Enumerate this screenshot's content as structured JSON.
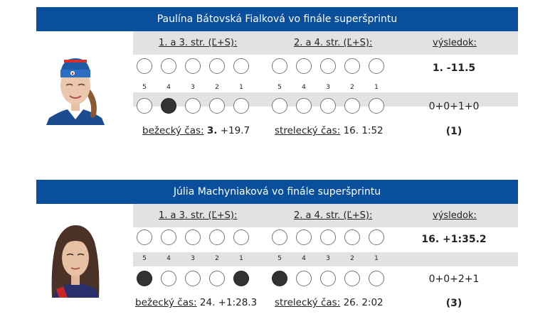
{
  "panels": [
    {
      "title": "Paulína Bátovská Fialková vo finále superšprintu",
      "col1": "1. a 3. str. (Ľ+S):",
      "col2": "2. a 4. str. (Ľ+S):",
      "col3": "výsledok:",
      "result": "1. -11.5",
      "penalties": "0+0+1+0",
      "misses": "(1)",
      "run_label": "bežecký čas:",
      "run_rank": "3.",
      "run_value": "+19.7",
      "shoot_label": "strelecký čas:",
      "shoot_value": "16. 1:52",
      "shooting": [
        [
          false,
          false,
          false,
          false,
          false,
          false,
          false,
          false,
          false,
          false
        ],
        [
          false,
          true,
          false,
          false,
          false,
          false,
          false,
          false,
          false,
          false
        ]
      ]
    },
    {
      "title": "Júlia Machyniaková vo finále superšprintu",
      "col1": "1. a 3. str. (Ľ+S):",
      "col2": "2. a 4. str. (Ľ+S):",
      "col3": "výsledok:",
      "result": "16. +1:35.2",
      "penalties": "0+0+2+1",
      "misses": "(3)",
      "run_label": "bežecký čas:",
      "run_rank": "",
      "run_value": "24. +1:28.3",
      "shoot_label": "strelecký čas:",
      "shoot_value": "26. 2:02",
      "shooting": [
        [
          false,
          false,
          false,
          false,
          false,
          false,
          false,
          false,
          false,
          false
        ],
        [
          true,
          false,
          false,
          false,
          true,
          true,
          false,
          false,
          false,
          false
        ]
      ]
    }
  ],
  "target_numbers": [
    "5",
    "4",
    "3",
    "2",
    "1"
  ],
  "colors": {
    "banner": "#0a4f9c",
    "row_gray": "#e2e2e2",
    "hit": "#333333"
  }
}
